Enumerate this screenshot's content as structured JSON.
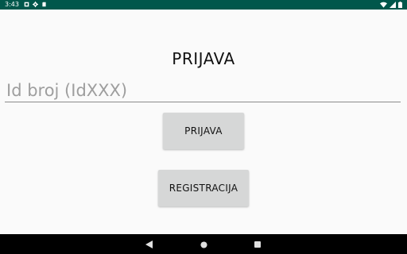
{
  "status_bar": {
    "time": "3:43",
    "icons": [
      "notification-icon",
      "settings-icon",
      "sd-card-icon",
      "wifi-icon",
      "signal-icon",
      "battery-icon"
    ],
    "background_color": "#00574b"
  },
  "main": {
    "title": "PRIJAVA",
    "id_input": {
      "value": "",
      "placeholder": "Id broj (IdXXX)"
    },
    "login_button_label": "PRIJAVA",
    "register_button_label": "REGISTRACIJA"
  },
  "nav_bar": {
    "icons": [
      "back-icon",
      "home-icon",
      "recents-icon"
    ]
  }
}
